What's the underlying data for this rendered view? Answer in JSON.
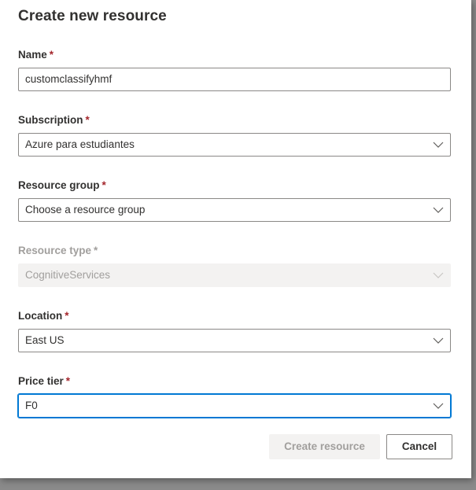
{
  "dialog": {
    "title": "Create new resource",
    "required_marker": "*"
  },
  "fields": {
    "name": {
      "label": "Name",
      "value": "customclassifyhmf"
    },
    "subscription": {
      "label": "Subscription",
      "value": "Azure para estudiantes"
    },
    "resource_group": {
      "label": "Resource group",
      "value": "Choose a resource group"
    },
    "resource_type": {
      "label": "Resource type",
      "value": "CognitiveServices"
    },
    "location": {
      "label": "Location",
      "value": "East US"
    },
    "price_tier": {
      "label": "Price tier",
      "value": "F0"
    }
  },
  "buttons": {
    "create_label": "Create resource",
    "cancel_label": "Cancel"
  },
  "colors": {
    "accent": "#0078d4",
    "required": "#a4262c",
    "text": "#323130",
    "disabled_text": "#a19f9d",
    "disabled_bg": "#f3f2f1"
  },
  "icons": {
    "dropdown": "chevron-down-icon"
  }
}
